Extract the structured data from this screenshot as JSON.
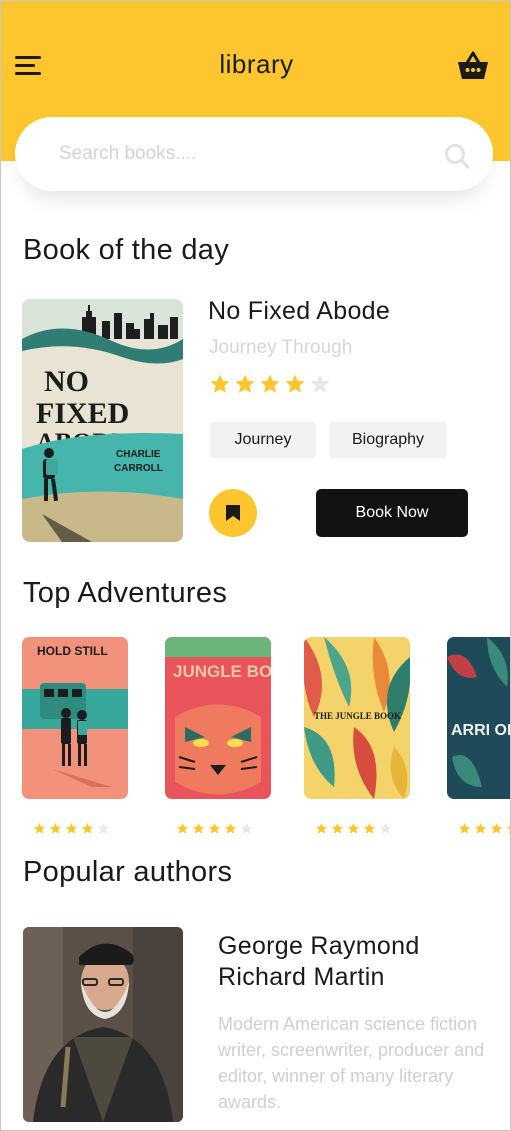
{
  "header": {
    "title": "library",
    "menu_icon": "hamburger-menu-icon",
    "cart_icon": "shopping-basket-icon",
    "background_color": "#fdc62f"
  },
  "search": {
    "placeholder": "Search books....",
    "value": "",
    "icon": "search-icon"
  },
  "book_of_the_day": {
    "section_title": "Book of the day",
    "title": "No Fixed Abode",
    "subtitle": "Journey Through",
    "rating": 4,
    "rating_max": 5,
    "tags": [
      "Journey",
      "Biography"
    ],
    "bookmark_icon": "bookmark-icon",
    "book_now_label": "Book Now",
    "cover": {
      "line1": "NO",
      "line2": "FIXED",
      "line3": "ABODE",
      "author_line1": "CHARLIE",
      "author_line2": "CARROLL"
    }
  },
  "top_adventures": {
    "section_title": "Top Adventures",
    "books": [
      {
        "cover_title": "HOLD STILL",
        "rating": 4,
        "rating_max": 5,
        "color": "#f08f7a"
      },
      {
        "cover_title": "JUNGLE BOOK",
        "rating": 4,
        "rating_max": 5,
        "color": "#e9545c"
      },
      {
        "cover_title": "THE JUNGLE BOOK",
        "rating": 4,
        "rating_max": 5,
        "color": "#e7b53a"
      },
      {
        "cover_title": "ARRI OF SOME",
        "rating": 4,
        "rating_max": 5,
        "color": "#1f4a5a"
      }
    ]
  },
  "popular_authors": {
    "section_title": "Popular authors",
    "authors": [
      {
        "name": "George Raymond Richard Martin",
        "bio": "Modern American science fiction writer, screenwriter, producer and editor, winner of many literary awards."
      }
    ]
  },
  "colors": {
    "accent": "#fdc62f",
    "star_filled": "#fdc62f",
    "star_empty": "#e8e8e8",
    "button_dark": "#121212"
  }
}
